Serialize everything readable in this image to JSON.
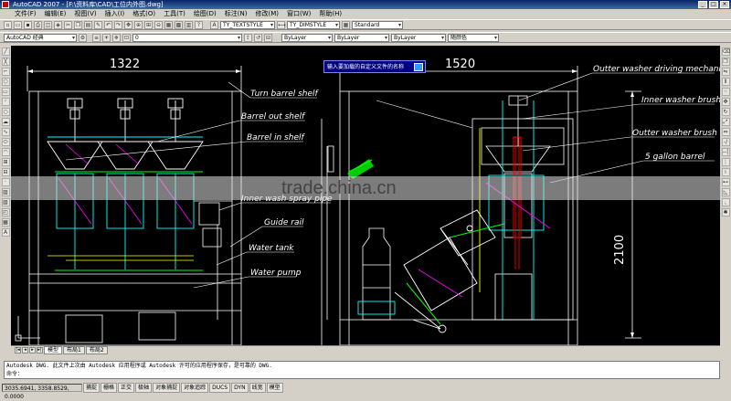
{
  "window": {
    "title": "AutoCAD 2007 - [F:\\资料库\\CAD\\工位内外图.dwg]"
  },
  "menu": [
    "文件(F)",
    "编辑(E)",
    "视图(V)",
    "插入(I)",
    "格式(O)",
    "工具(T)",
    "绘图(D)",
    "标注(N)",
    "修改(M)",
    "窗口(W)",
    "帮助(H)"
  ],
  "toolbar": {
    "workspace": "AutoCAD 经典",
    "textstyle": "TY_TEXTSTYLE",
    "dimstyle": "TY_DIMSTYLE",
    "tablestyle": "Standard",
    "layer": "0",
    "color": "ByLayer",
    "linetype": "ByLayer",
    "lineweight": "ByLayer",
    "plotstyle": "随颜色"
  },
  "drawing": {
    "dim_left": "1322",
    "dim_right": "1520",
    "dim_height": "2100",
    "labels": {
      "turn_barrel_shelf": "Turn barrel shelf",
      "barrel_out_shelf": "Barrel out shelf",
      "barrel_in_shelf": "Barrel in shelf",
      "inner_wash_spray_pipe": "Inner wash spray pipe",
      "guide_rail": "Guide rail",
      "water_tank": "Water tank",
      "water_pump": "Water pump",
      "outter_washer_driving": "Outter washer driving mechanis",
      "inner_washer_brush": "Inner washer brush",
      "outter_washer_brush": "Outter washer brush",
      "five_gallon_barrel": "5 gallon barrel"
    },
    "prompt": "输入要加载的自定义文件的名称"
  },
  "watermark": "trade.china.cn",
  "tabs": [
    "模型",
    "布局1",
    "布局2"
  ],
  "command": {
    "line1": "Autodesk DWG.  此文件上次由 Autodesk 应用程序或 Autodesk 许可的应用程序保存，是可靠的 DWG.",
    "line2": "命令："
  },
  "status": {
    "coords": "3035.6941, 3358.8529, 0.0000",
    "buttons": [
      "捕捉",
      "栅格",
      "正交",
      "极轴",
      "对象捕捉",
      "对象追踪",
      "DUCS",
      "DYN",
      "线宽",
      "模型"
    ]
  },
  "colors": {
    "canvas": "#000000",
    "line": "#ffffff",
    "accent_cyan": "#00ffff",
    "accent_green": "#00ff00",
    "accent_magenta": "#ff00ff",
    "accent_red": "#ff0000",
    "accent_yellow": "#ffff00"
  }
}
